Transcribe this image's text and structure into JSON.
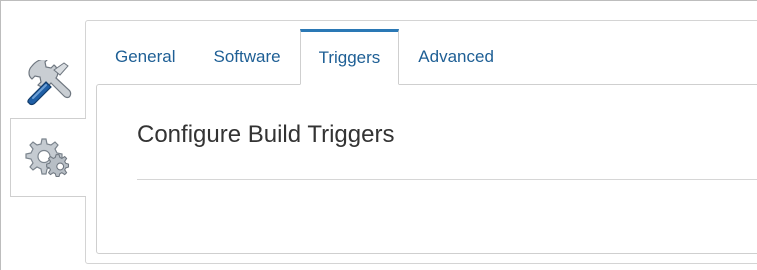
{
  "side_tabs": [
    {
      "icon": "tools-icon",
      "label": ""
    },
    {
      "icon": "gears-icon",
      "label": ""
    }
  ],
  "tabs": [
    {
      "label": "General"
    },
    {
      "label": "Software"
    },
    {
      "label": "Triggers",
      "active": true
    },
    {
      "label": "Advanced"
    }
  ],
  "content": {
    "title": "Configure Build Triggers"
  },
  "colors": {
    "tab_text": "#1e5f95",
    "active_tab_accent": "#2a78b5",
    "title_text": "#333333",
    "border": "#cfcfcf"
  }
}
